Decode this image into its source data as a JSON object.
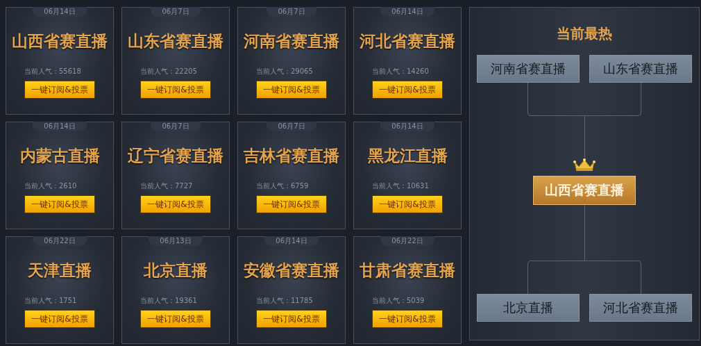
{
  "cards": [
    {
      "date": "06月14日",
      "title": "山西省赛直播",
      "popularity": "当前人气：55618",
      "button": "一键订阅&投票"
    },
    {
      "date": "06月7日",
      "title": "山东省赛直播",
      "popularity": "当前人气：22205",
      "button": "一键订阅&投票"
    },
    {
      "date": "06月7日",
      "title": "河南省赛直播",
      "popularity": "当前人气：29065",
      "button": "一键订阅&投票"
    },
    {
      "date": "06月14日",
      "title": "河北省赛直播",
      "popularity": "当前人气：14260",
      "button": "一键订阅&投票"
    },
    {
      "date": "06月14日",
      "title": "内蒙古直播",
      "popularity": "当前人气：2610",
      "button": "一键订阅&投票"
    },
    {
      "date": "06月7日",
      "title": "辽宁省赛直播",
      "popularity": "当前人气：7727",
      "button": "一键订阅&投票"
    },
    {
      "date": "06月7日",
      "title": "吉林省赛直播",
      "popularity": "当前人气：6759",
      "button": "一键订阅&投票"
    },
    {
      "date": "06月14日",
      "title": "黑龙江直播",
      "popularity": "当前人气：10631",
      "button": "一键订阅&投票"
    },
    {
      "date": "06月22日",
      "title": "天津直播",
      "popularity": "当前人气：1751",
      "button": "一键订阅&投票"
    },
    {
      "date": "06月13日",
      "title": "北京直播",
      "popularity": "当前人气：19361",
      "button": "一键订阅&投票"
    },
    {
      "date": "06月14日",
      "title": "安徽省赛直播",
      "popularity": "当前人气：11785",
      "button": "一键订阅&投票"
    },
    {
      "date": "06月22日",
      "title": "甘肃省赛直播",
      "popularity": "当前人气：5039",
      "button": "一键订阅&投票"
    }
  ],
  "hot_panel": {
    "title": "当前最热",
    "top_pair": [
      "河南省赛直播",
      "山东省赛直播"
    ],
    "winner": "山西省赛直播",
    "bottom_pair": [
      "北京直播",
      "河北省赛直播"
    ]
  }
}
